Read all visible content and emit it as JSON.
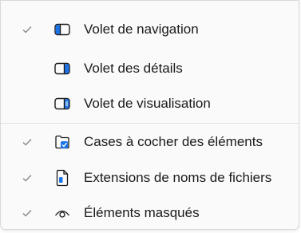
{
  "menu": {
    "items": [
      {
        "label": "Volet de navigation",
        "checked": true,
        "icon": "navigation-pane-icon"
      },
      {
        "label": "Volet des détails",
        "checked": false,
        "icon": "details-pane-icon"
      },
      {
        "label": "Volet de visualisation",
        "checked": false,
        "icon": "preview-pane-icon"
      },
      {
        "label": "Cases à cocher des éléments",
        "checked": true,
        "icon": "item-checkboxes-icon"
      },
      {
        "label": "Extensions de noms de fichiers",
        "checked": true,
        "icon": "file-extension-icon"
      },
      {
        "label": "Éléments masqués",
        "checked": true,
        "icon": "hidden-items-eye-icon"
      }
    ]
  },
  "colors": {
    "accent": "#1a73e8",
    "text": "#1a1a1a",
    "checkmark": "#8a8a8a"
  }
}
